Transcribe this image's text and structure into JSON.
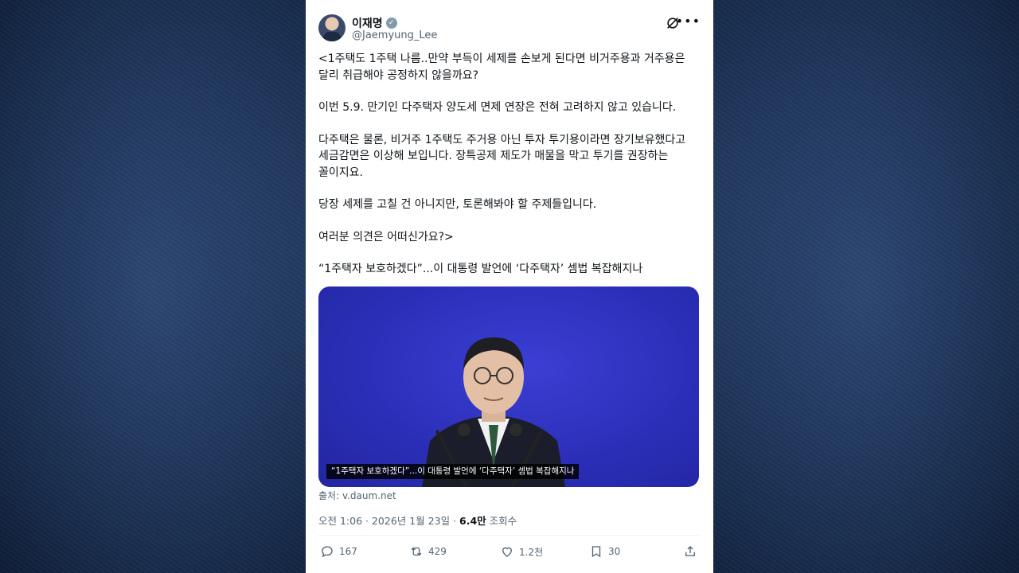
{
  "author": {
    "display_name": "이재명",
    "handle": "@Jaemyung_Lee",
    "verified_icon": "verified-badge-icon"
  },
  "post": {
    "paragraphs": [
      "<1주택도 1주택 나름..만약 부득이 세제를 손보게 된다면 비거주용과 거주용은 달리 취급해야 공정하지 않을까요?",
      "이번 5.9. 만기인 다주택자 양도세 면제 연장은 전혀 고려하지 않고 있습니다.",
      "다주택은 물론, 비거주 1주택도 주거용 아닌 투자 투기용이라면 장기보유했다고 세금감면은 이상해 보입니다. 장특공제 제도가 매물을 막고 투기를 권장하는 꼴이지요.",
      "당장 세제를 고칠 건 아니지만, 토론해봐야 할 주제들입니다.",
      "여러분 의견은 어떠신가요?>"
    ],
    "link_title": "“1주택자 보호하겠다”...이 대통령 발언에 ‘다주택자’ 셈법 복잡해지나"
  },
  "media": {
    "caption": "“1주택자 보호하겠다”...이 대통령 발언에 ‘다주택자’ 셈법 복잡해지나",
    "background_color": "#2b2fb8"
  },
  "source": "출처: v.daum.net",
  "meta": {
    "timestamp": "오전 1:06 · 2026년 1월 23일 · ",
    "views_count": "6.4만",
    "views_label": " 조회수"
  },
  "actions": {
    "replies": "167",
    "reposts": "429",
    "likes": "1.2천",
    "bookmarks": "30"
  },
  "colors": {
    "text_primary": "#0f1419",
    "text_secondary": "#536471",
    "backdrop": "#1c3358"
  }
}
